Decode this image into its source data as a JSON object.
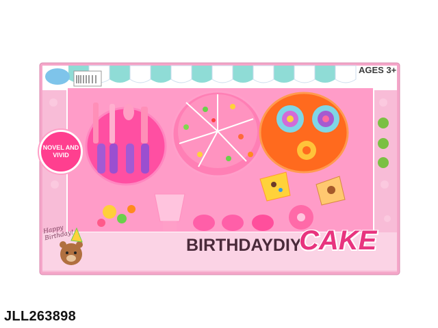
{
  "product_code": "JLL263898",
  "age_label": "AGES 3+",
  "title": {
    "part1": "BIRTHDAYDIY",
    "part2": "CAKE"
  },
  "badge": {
    "line1": "NOVEL AND",
    "line2": "VIVID"
  },
  "happy_birthday": {
    "line1": "Happy",
    "line2": "Birthday!"
  },
  "colors": {
    "box_pink": "#f7a9cc",
    "awning_teal": "#8fdcd6",
    "accent_pink": "#e8347f"
  },
  "icons": [
    "fork-icon",
    "spoon-icon",
    "knife-icon",
    "cake-icon",
    "bear-icon",
    "lollipop-icon",
    "donut-icon"
  ]
}
